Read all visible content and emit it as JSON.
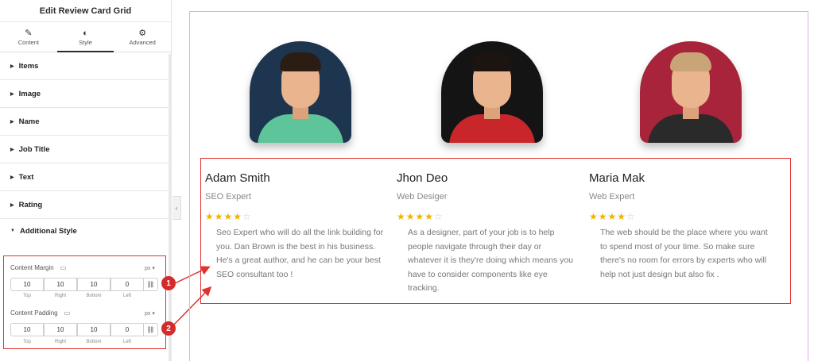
{
  "panel": {
    "header": "Edit Review Card Grid",
    "tabs": [
      {
        "label": "Content",
        "icon": "pencil-icon"
      },
      {
        "label": "Style",
        "icon": "contrast-icon"
      },
      {
        "label": "Advanced",
        "icon": "gear-icon"
      }
    ],
    "sections": [
      "Items",
      "Image",
      "Name",
      "Job Title",
      "Text",
      "Rating"
    ],
    "additional_style": "Additional Style",
    "content_margin": {
      "label": "Content Margin",
      "unit": "px",
      "values": [
        "10",
        "10",
        "10",
        "0"
      ],
      "labels": [
        "Top",
        "Right",
        "Bottom",
        "Left"
      ]
    },
    "content_padding": {
      "label": "Content Padding",
      "unit": "px",
      "values": [
        "10",
        "10",
        "10",
        "0"
      ],
      "labels": [
        "Top",
        "Right",
        "Bottom",
        "Left"
      ]
    },
    "badges": [
      "1",
      "2"
    ]
  },
  "cards": [
    {
      "name": "Adam Smith",
      "job": "SEO Expert",
      "rating": 4,
      "stars_filled": "★★★★",
      "stars_empty": "☆",
      "text": "Seo Expert who will do all the link building for you. Dan Brown is the best in his business. He's a great author, and he can be your best SEO consultant too !",
      "bg": "#1e3550",
      "shirt": "#5ec49a",
      "hair": "#2b1d14"
    },
    {
      "name": "Jhon Deo",
      "job": "Web Desiger",
      "rating": 4,
      "stars_filled": "★★★★",
      "stars_empty": "☆",
      "text": "As a designer, part of your job is to help people navigate through their day or whatever it is they're doing which means you have to consider components like eye tracking.",
      "bg": "#141414",
      "shirt": "#c8262b",
      "hair": "#1c1410"
    },
    {
      "name": "Maria Mak",
      "job": "Web Expert",
      "rating": 4,
      "stars_filled": "★★★★",
      "stars_empty": "☆",
      "text": "The web should be the place where you want to spend most of your time. So make sure there's no room for errors by experts who will help not just design but also fix .",
      "bg": "#a8243a",
      "shirt": "#2a2a2a",
      "hair": "#c9a476"
    }
  ]
}
